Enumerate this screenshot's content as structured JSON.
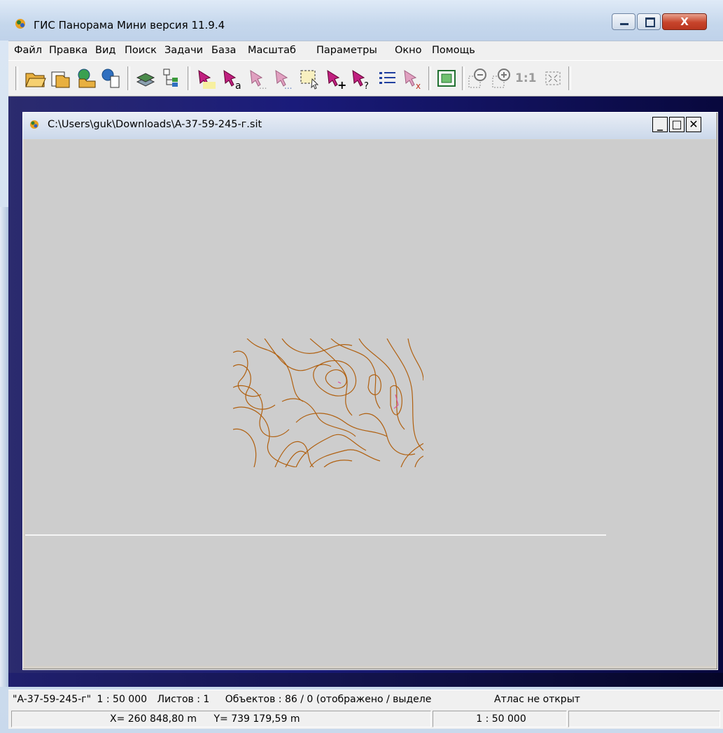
{
  "window": {
    "title": "ГИС Панорама Мини версия 11.9.4",
    "close_symbol": "X"
  },
  "menu": [
    "Файл",
    "Правка",
    "Вид",
    "Поиск",
    "Задачи",
    "База",
    "Масштаб",
    "Параметры",
    "Окно",
    "Помощь"
  ],
  "toolbar": {
    "scale_one_label": "1:1",
    "icons": [
      "open-folder-icon",
      "open-files-icon",
      "open-globe-icon",
      "open-doc-globe-icon",
      "layers-icon",
      "tree-icon",
      "select-object-icon",
      "select-text-icon",
      "select-dots-icon",
      "select-dots2-icon",
      "select-area-icon",
      "add-object-icon",
      "query-object-icon",
      "list-icon",
      "deselect-icon",
      "fit-window-icon",
      "zoom-out-icon",
      "zoom-in-icon",
      "scale-one-icon",
      "full-extent-icon"
    ]
  },
  "child_window": {
    "path": "C:\\Users\\guk\\Downloads\\A-37-59-245-г.sit",
    "min_symbol": "_",
    "max_symbol": "□",
    "close_symbol": "✕"
  },
  "colors": {
    "contour": "#b06010",
    "map_bg": "#cdcdcd",
    "accent_pink": "#e040a0"
  },
  "status": {
    "map_name": "\"A-37-59-245-г\"",
    "scale": "1 : 50 000",
    "sheets": "Листов : 1",
    "objects": "Объектов : 86 / 0 (отображено / выделе",
    "atlas": "Атлас не открыт",
    "x_coord": "X=  260 848,80 m",
    "y_coord": "Y=  739 179,59 m",
    "scale2": "1 : 50 000"
  }
}
